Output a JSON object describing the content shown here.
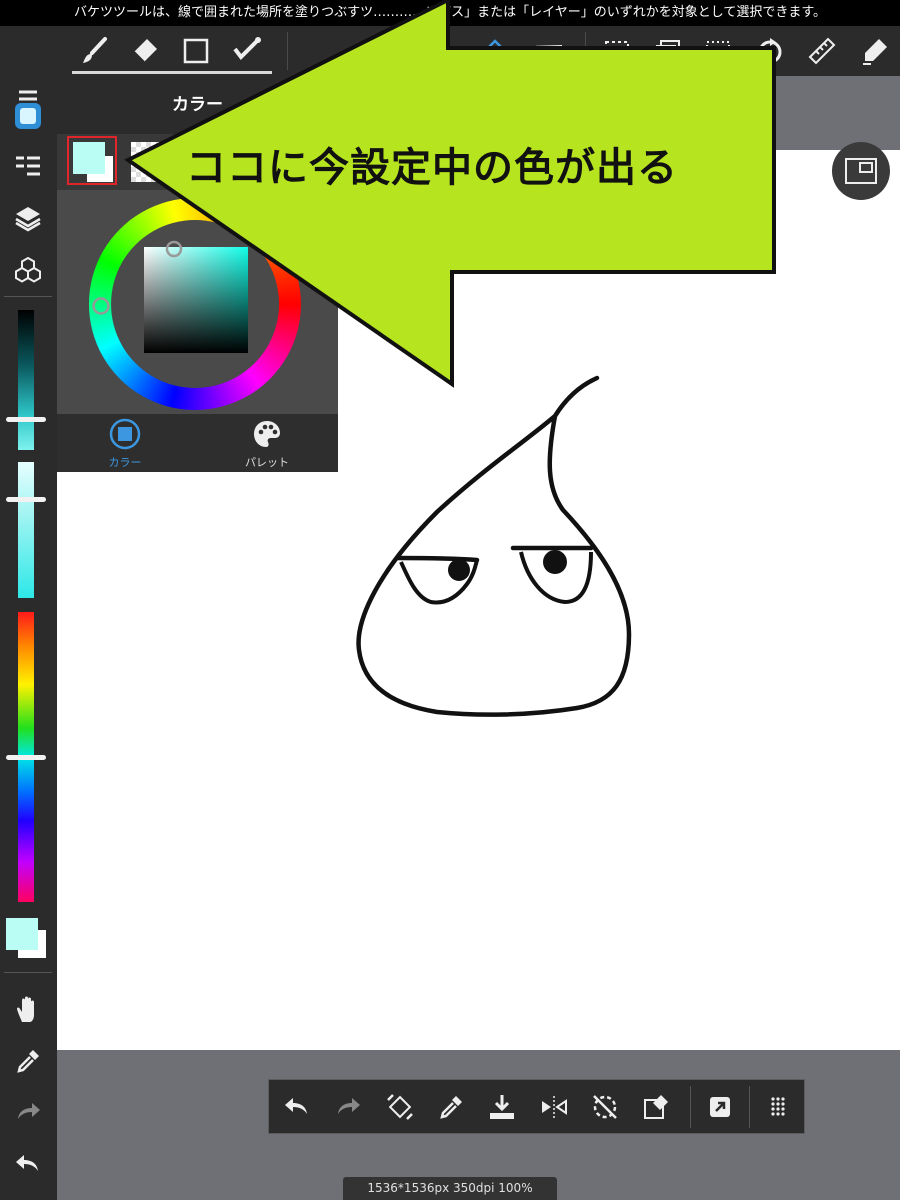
{
  "status_bar": {
    "text": "バケツツールは、線で囲まれた場所を塗りつぶすツ…………ンバス」または「レイヤー」のいずれかを対象として選択できます。"
  },
  "toolbar": {
    "tools": [
      {
        "name": "brush-icon",
        "label": "Brush"
      },
      {
        "name": "eraser-icon",
        "label": "Eraser"
      },
      {
        "name": "rectangle-icon",
        "label": "Shape"
      },
      {
        "name": "dot-pen-icon",
        "label": "Dot pen"
      }
    ],
    "right_tools": [
      {
        "name": "bucket-icon"
      },
      {
        "name": "gradient-icon"
      },
      {
        "name": "select-icon"
      },
      {
        "name": "layers-copy-icon"
      },
      {
        "name": "lasso-select-icon"
      },
      {
        "name": "rotate-icon"
      },
      {
        "name": "ruler-icon"
      },
      {
        "name": "snap-pen-icon"
      }
    ]
  },
  "sidebar": {
    "items": [
      {
        "name": "menu-icon"
      },
      {
        "name": "color-panel-icon"
      },
      {
        "name": "brush-list-icon"
      },
      {
        "name": "layers-icon"
      },
      {
        "name": "materials-icon"
      }
    ],
    "brush_size_level": 0.78,
    "brush_opacity_level": 0.27,
    "hue_level": 0.5,
    "bottom_items": [
      {
        "name": "hand-icon"
      },
      {
        "name": "eyedropper-icon"
      },
      {
        "name": "redo-icon"
      },
      {
        "name": "undo-icon"
      }
    ]
  },
  "colors": {
    "current": "#b9fdf4",
    "secondary": "#ffffff",
    "accent": "#2f8fd6",
    "callout_fill": "#b6e41e"
  },
  "color_panel": {
    "title": "カラー",
    "tabs": [
      {
        "name": "tab-color",
        "label": "カラー",
        "active": true
      },
      {
        "name": "tab-palette",
        "label": "パレット",
        "active": false
      }
    ]
  },
  "callout": {
    "text": "ココに今設定中の色が出る"
  },
  "bottom_bar": {
    "actions": [
      {
        "name": "undo-icon"
      },
      {
        "name": "redo-icon"
      },
      {
        "name": "transform-icon"
      },
      {
        "name": "eyedropper-icon"
      },
      {
        "name": "import-icon"
      },
      {
        "name": "flip-icon"
      },
      {
        "name": "rotate-reset-icon"
      },
      {
        "name": "canvas-eraser-icon"
      },
      {
        "name": "share-icon"
      },
      {
        "name": "more-icon"
      }
    ]
  },
  "canvas_info": {
    "text": "1536*1536px 350dpi 100%"
  }
}
